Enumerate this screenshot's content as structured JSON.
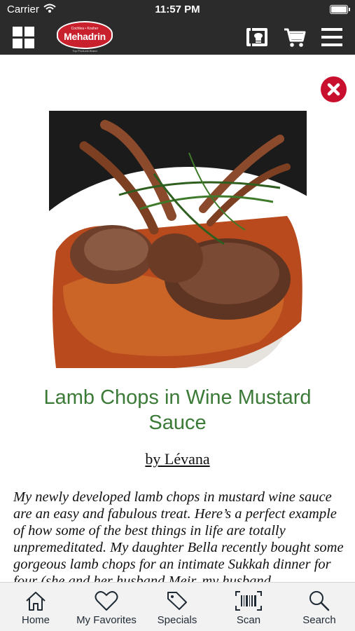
{
  "status_bar": {
    "carrier": "Carrier",
    "time": "11:57 PM"
  },
  "nav": {
    "logo": {
      "top_text": "Cochlea • Kosher",
      "brand": "Mehadrin",
      "tagline": "Top Products Brand"
    },
    "icons": [
      "grid-menu-icon",
      "recipes-icon",
      "cart-icon",
      "hamburger-menu-icon"
    ]
  },
  "recipe": {
    "title": "Lamb Chops in Wine Mustard Sauce",
    "author": "by Lévana",
    "body": "My newly developed lamb chops in mustard wine sauce are an easy and fabulous treat. Here’s a perfect example of how some of the best things in life are totally unpremeditated. My daughter Bella recently bought some gorgeous lamb chops for an intimate Sukkah dinner for four (she and her husband Meir, my husband",
    "image": "lamb-chops-photo"
  },
  "tabs": [
    {
      "label": "Home",
      "icon": "home-icon"
    },
    {
      "label": "My Favorites",
      "icon": "heart-icon"
    },
    {
      "label": "Specials",
      "icon": "tag-icon"
    },
    {
      "label": "Scan",
      "icon": "barcode-icon"
    },
    {
      "label": "Search",
      "icon": "search-icon"
    }
  ],
  "colors": {
    "bar": "#2b2b2b",
    "accent": "#c8102e",
    "title": "#3b7a37",
    "tab_bar": "#f2f2f2"
  }
}
